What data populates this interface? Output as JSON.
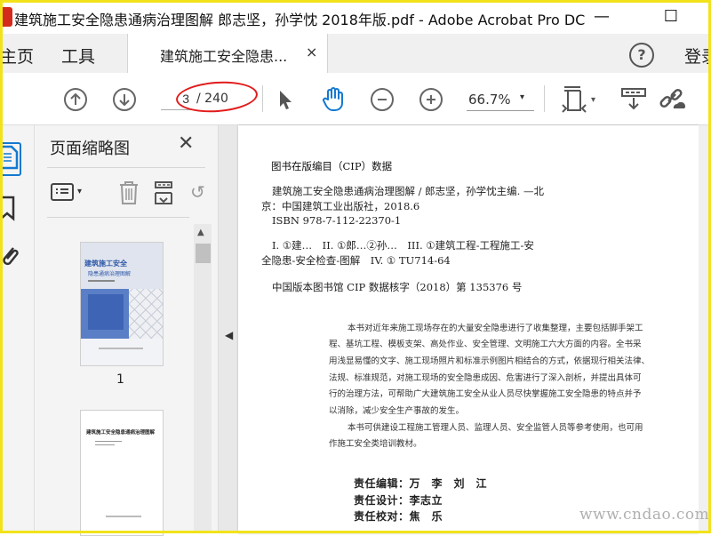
{
  "window": {
    "title": "建筑施工安全隐患通病治理图解 郎志坚，孙学忱 2018年版.pdf - Adobe Acrobat Pro DC",
    "minimize_glyph": "—",
    "maximize_glyph": "☐"
  },
  "tabs": {
    "home": "主页",
    "tools": "工具",
    "document": "建筑施工安全隐患...",
    "close_glyph": "×",
    "help_glyph": "?",
    "signin": "登录"
  },
  "toolbar": {
    "current_page": "3",
    "total_pages": "/ 240",
    "zoom": "66.7%",
    "icons": [
      "prev-page-icon",
      "next-page-icon",
      "select-arrow-icon",
      "hand-icon",
      "zoom-out-icon",
      "zoom-in-icon",
      "page-fit-icon",
      "read-mode-icon",
      "share-link-icon"
    ],
    "annotation_color": "#e21b1b"
  },
  "thumbnail_panel": {
    "title": "页面缩略图",
    "close_glyph": "✕",
    "thumbnails": [
      {
        "label": "1",
        "cover_title": "建筑施工安全",
        "cover_subtitle": "隐患通病治理图解"
      },
      {
        "label": "",
        "cover_title": "建筑施工安全隐患通病治理图解"
      }
    ]
  },
  "document_page": {
    "cip_heading": "图书在版编目（CIP）数据",
    "cip_lines": [
      "建筑施工安全隐患通病治理图解 / 郎志坚，孙学忱主编. —北",
      "京：中国建筑工业出版社，2018.6",
      "ISBN 978-7-112-22370-1",
      "I. ①建…　II. ①郎…②孙…　III. ①建筑工程-工程施工-安",
      "全隐患-安全检查-图解　IV. ① TU714-64",
      "中国版本图书馆 CIP 数据核字（2018）第 135376 号"
    ],
    "abstract_lines": [
      "本书对近年来施工现场存在的大量安全隐患进行了收集整理，主要包括脚手架工",
      "程、基坑工程、模板支架、高处作业、安全管理、文明施工六大方面的内容。全书采",
      "用浅显易懂的文字、施工现场照片和标准示例图片相结合的方式，依据现行相关法律、",
      "法规、标准规范，对施工现场的安全隐患成因、危害进行了深入剖析，并提出具体可",
      "行的治理方法，可帮助广大建筑施工安全从业人员尽快掌握施工安全隐患的特点并予",
      "以消除，减少安全生产事故的发生。",
      "本书可供建设工程施工管理人员、监理人员、安全监管人员等参考使用，也可用",
      "作施工安全类培训教材。"
    ],
    "credits": [
      "责任编辑：万　李　刘　江",
      "责任设计：李志立",
      "责任校对：焦　乐"
    ]
  },
  "watermark": "www.cndao.com",
  "colors": {
    "accent_blue": "#1479d0",
    "title_bar": "#ffffff",
    "frame": "#f2e21a"
  }
}
